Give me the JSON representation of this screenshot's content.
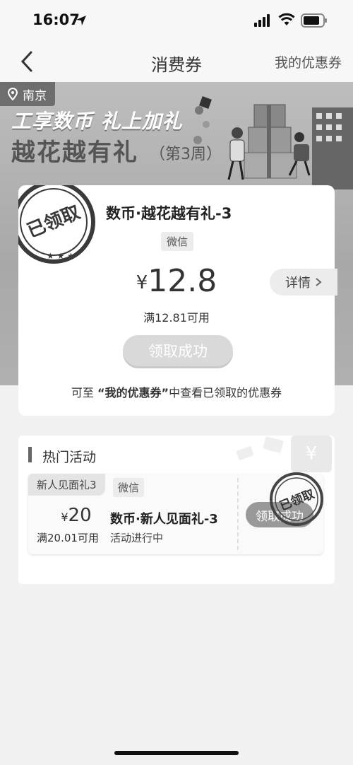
{
  "status_bar": {
    "time": "16:07"
  },
  "nav": {
    "title": "消费券",
    "right_link": "我的优惠券"
  },
  "banner": {
    "location": "南京",
    "line1": "工享数币 礼上加礼",
    "title": "越花越有礼",
    "week": "（第3周）"
  },
  "coupon": {
    "stamp_text": "已领取",
    "name": "数币·越花越有礼-3",
    "platform": "微信",
    "currency": "¥",
    "amount": "12.8",
    "detail_label": "详情",
    "threshold": "满12.81可用",
    "claim_button": "领取成功",
    "hint_prefix": "可至 ",
    "hint_link": "“我的优惠券”",
    "hint_suffix": "中查看已领取的优惠券"
  },
  "hot": {
    "title": "热门活动",
    "item": {
      "tag": "新人见面礼3",
      "platform": "微信",
      "currency": "¥",
      "amount": "20",
      "threshold": "满20.01可用",
      "name": "数币·新人见面礼-3",
      "status": "活动进行中",
      "button": "领取成功",
      "stamp_text": "已领取"
    }
  }
}
